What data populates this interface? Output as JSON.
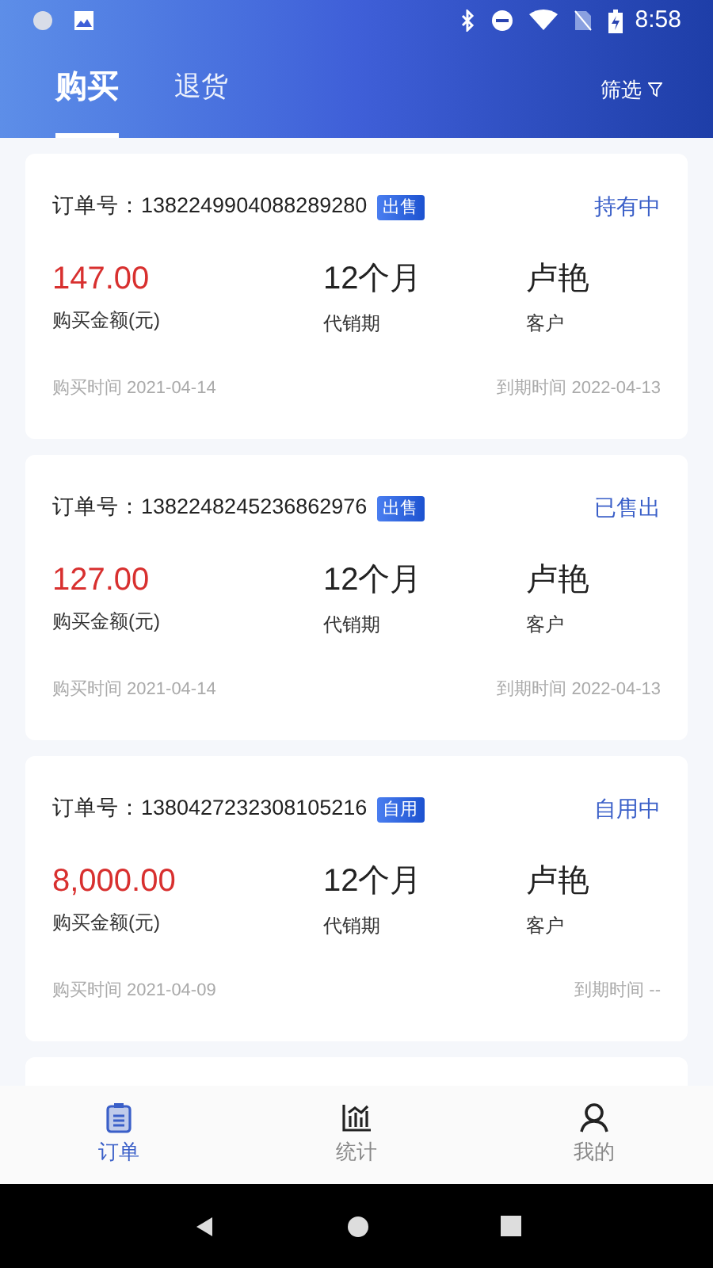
{
  "status_bar": {
    "time": "8:58"
  },
  "tabs": [
    {
      "label": "购买",
      "selected": true
    },
    {
      "label": "退货",
      "selected": false
    }
  ],
  "filter": {
    "label": "筛选"
  },
  "orders": [
    {
      "order_label": "订单号：",
      "order_no": "1382249904088289280",
      "tag": "出售",
      "status": "持有中",
      "amount": "147.00",
      "amount_label": "购买金额(元)",
      "period": "12个月",
      "period_label": "代销期",
      "customer": "卢艳",
      "customer_label": "客户",
      "bought": "购买时间 2021-04-14",
      "expires": "到期时间 2022-04-13"
    },
    {
      "order_label": "订单号：",
      "order_no": "1382248245236862976",
      "tag": "出售",
      "status": "已售出",
      "amount": "127.00",
      "amount_label": "购买金额(元)",
      "period": "12个月",
      "period_label": "代销期",
      "customer": "卢艳",
      "customer_label": "客户",
      "bought": "购买时间 2021-04-14",
      "expires": "到期时间 2022-04-13"
    },
    {
      "order_label": "订单号：",
      "order_no": "1380427232308105216",
      "tag": "自用",
      "status": "自用中",
      "amount": "8,000.00",
      "amount_label": "购买金额(元)",
      "period": "12个月",
      "period_label": "代销期",
      "customer": "卢艳",
      "customer_label": "客户",
      "bought": "购买时间 2021-04-09",
      "expires": "到期时间 --"
    }
  ],
  "bottom_nav": [
    {
      "kind": "orders",
      "label": "订单",
      "selected": true
    },
    {
      "kind": "stats",
      "label": "统计",
      "selected": false
    },
    {
      "kind": "profile",
      "label": "我的",
      "selected": false
    }
  ]
}
